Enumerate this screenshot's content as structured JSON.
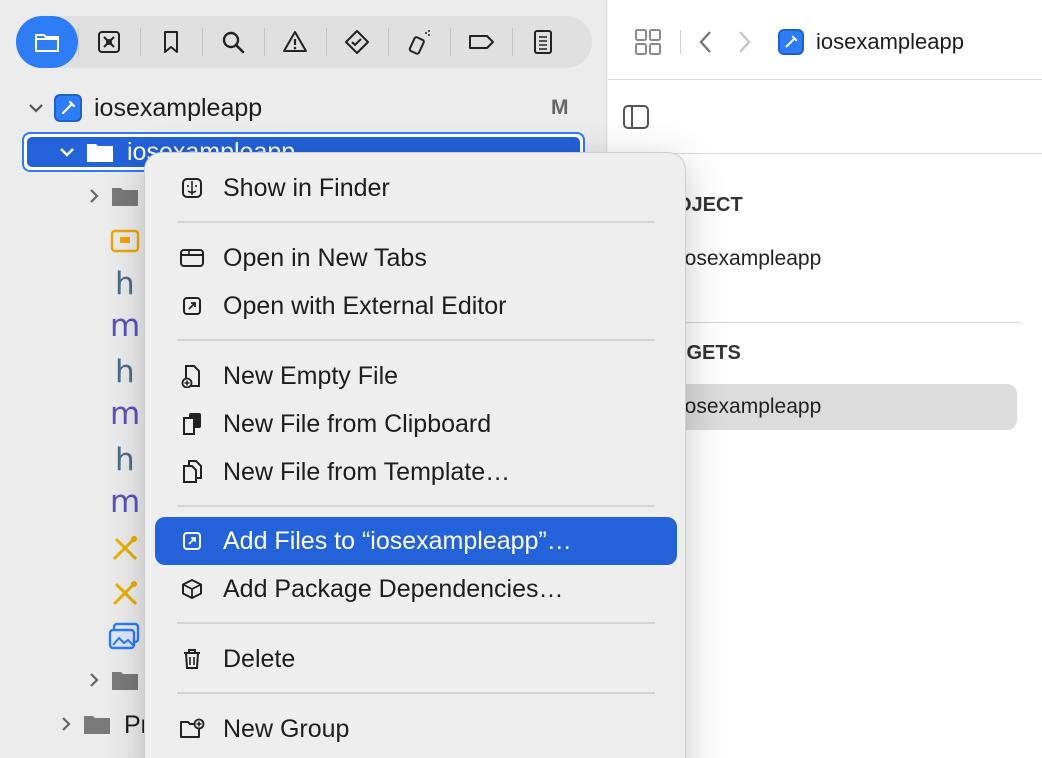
{
  "navigator": {
    "tabs": [
      "folder-icon",
      "x-square-icon",
      "bookmark-icon",
      "search-icon",
      "warning-icon",
      "diamond-check-icon",
      "spray-icon",
      "tag-icon",
      "report-icon"
    ],
    "project_name": "iosexampleapp",
    "project_badge": "M",
    "selected_group": "iosexampleapp",
    "partial_row_text": "Pr"
  },
  "editor": {
    "breadcrumb_title": "iosexampleapp",
    "project_header": "OJECT",
    "project_item": "iosexampleapp",
    "targets_header": "RGETS",
    "target_item": "iosexampleapp"
  },
  "context_menu": {
    "show_in_finder": "Show in Finder",
    "open_in_new_tabs": "Open in New Tabs",
    "open_external": "Open with External Editor",
    "new_empty_file": "New Empty File",
    "new_file_clipboard": "New File from Clipboard",
    "new_file_template": "New File from Template…",
    "add_files": "Add Files to “iosexampleapp”…",
    "add_package": "Add Package Dependencies…",
    "delete": "Delete",
    "new_group": "New Group"
  },
  "colors": {
    "accent": "#2e7cf6",
    "selection": "#2362d9",
    "menu_bg": "#eeeeef"
  }
}
